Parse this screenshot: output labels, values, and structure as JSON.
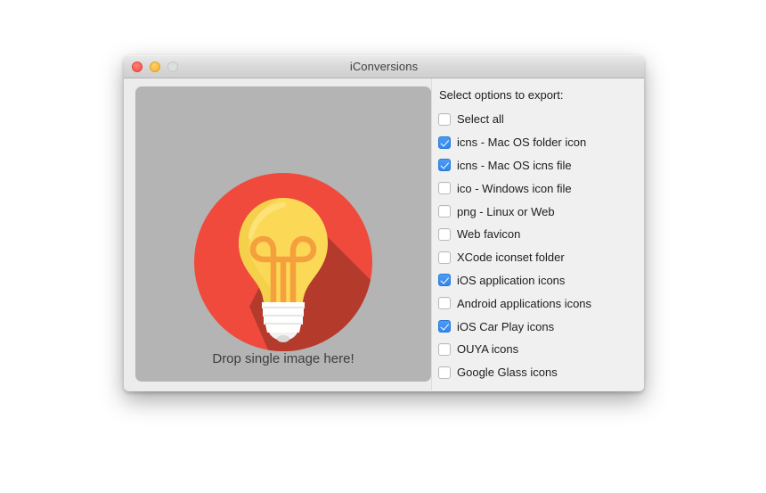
{
  "window": {
    "title": "iConversions",
    "traffic_lights": [
      {
        "name": "close",
        "color": "#FB5F55"
      },
      {
        "name": "minimize",
        "color": "#FDBC40"
      },
      {
        "name": "zoom",
        "color": "#DEDEDE"
      }
    ]
  },
  "dropzone": {
    "label": "Drop single image here!",
    "background": "#B4B4B4",
    "artwork": {
      "name": "lightbulb-icon",
      "circle_color": "#EF4A3C",
      "shadow_color": "#B43A2C",
      "bulb_color": "#FBD957",
      "bulb_highlight": "#F7CE4A",
      "filament_color": "#F5A03C",
      "base_color": "#FFFFFF",
      "base_shade": "#E8E8E6"
    }
  },
  "options": {
    "heading": "Select options to export:",
    "items": [
      {
        "label": "Select all",
        "checked": false
      },
      {
        "label": "icns - Mac OS folder icon",
        "checked": true
      },
      {
        "label": "icns - Mac OS icns file",
        "checked": true
      },
      {
        "label": "ico - Windows icon file",
        "checked": false
      },
      {
        "label": "png - Linux or Web",
        "checked": false
      },
      {
        "label": "Web favicon",
        "checked": false
      },
      {
        "label": "XCode iconset folder",
        "checked": false
      },
      {
        "label": "iOS application icons",
        "checked": true
      },
      {
        "label": "Android applications icons",
        "checked": false
      },
      {
        "label": "iOS Car Play icons",
        "checked": true
      },
      {
        "label": "OUYA icons",
        "checked": false
      },
      {
        "label": "Google Glass icons",
        "checked": false
      }
    ],
    "accent_checked": "#2F86EF",
    "background": "#F0F0F0"
  }
}
